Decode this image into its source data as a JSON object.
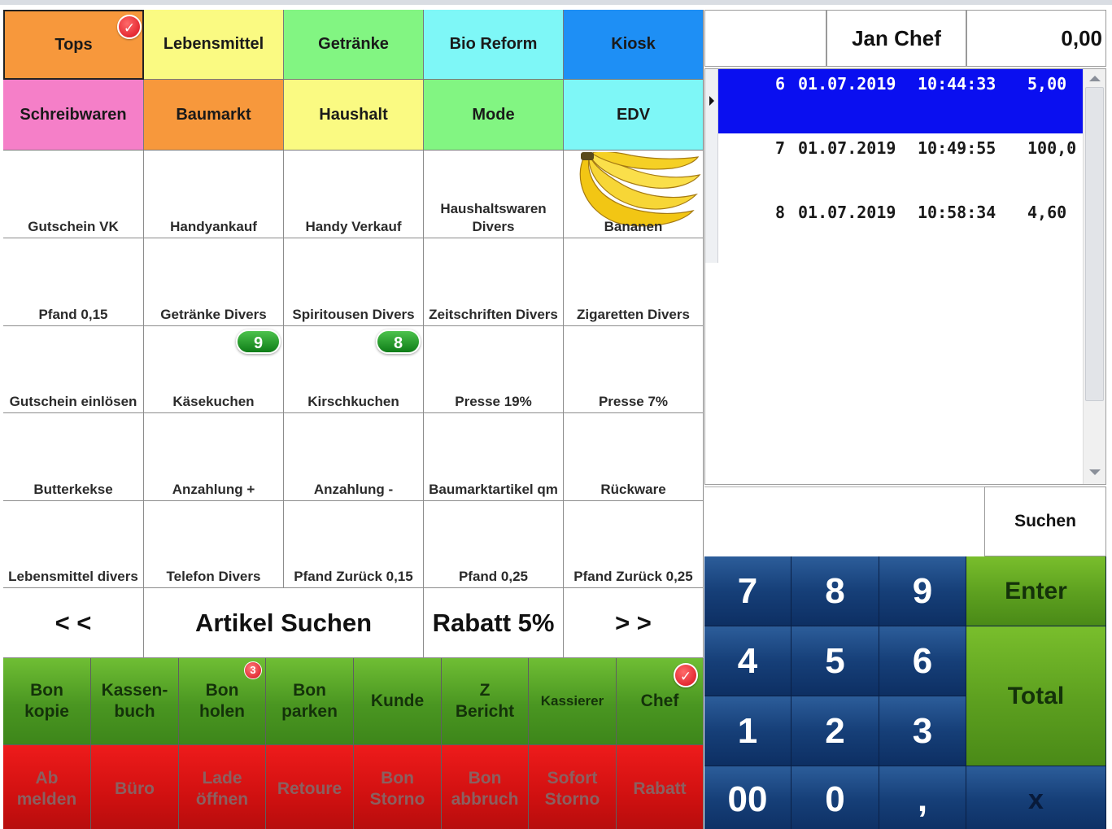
{
  "categories": [
    {
      "label": "Tops",
      "color": "#f7983c"
    },
    {
      "label": "Lebensmittel",
      "color": "#fafa82"
    },
    {
      "label": "Getränke",
      "color": "#82f582"
    },
    {
      "label": "Bio Reform",
      "color": "#7ef7f7"
    },
    {
      "label": "Kiosk",
      "color": "#1e8ff5"
    },
    {
      "label": "Schreibwaren",
      "color": "#f57fc8"
    },
    {
      "label": "Baumarkt",
      "color": "#f7983c"
    },
    {
      "label": "Haushalt",
      "color": "#fafa82"
    },
    {
      "label": "Mode",
      "color": "#82f582"
    },
    {
      "label": "EDV",
      "color": "#7ef7f7"
    }
  ],
  "tops_badge": "✓",
  "articles": [
    "Gutschein VK",
    "Handyankauf",
    "Handy Verkauf",
    "Haushaltswaren Divers",
    "Bananen",
    "Pfand 0,15",
    "Getränke Divers",
    "Spiritousen Divers",
    "Zeitschriften Divers",
    "Zigaretten Divers",
    "Gutschein einlösen",
    "Käsekuchen",
    "Kirschkuchen",
    "Presse 19%",
    "Presse 7%",
    "Butterkekse",
    "Anzahlung +",
    "Anzahlung -",
    "Baumarktartikel qm",
    "Rückware",
    "Lebensmittel divers",
    "Telefon Divers",
    "Pfand Zurück 0,15",
    "Pfand 0,25",
    "Pfand Zurück 0,25"
  ],
  "article_badges": {
    "kaesekuchen": "9",
    "kirschkuchen": "8"
  },
  "nav": {
    "prev": "< <",
    "search": "Artikel Suchen",
    "discount": "Rabatt 5%",
    "next": "> >"
  },
  "functions_green": [
    "Bon kopie",
    "Kassen- buch",
    "Bon holen",
    "Bon parken",
    "Kunde",
    "Z Bericht",
    "Kassierer",
    "Chef"
  ],
  "bon_holen_badge": "3",
  "chef_badge": "✓",
  "functions_red": [
    "Ab melden",
    "Büro",
    "Lade öffnen",
    "Retoure",
    "Bon Storno",
    "Bon abbruch",
    "Sofort Storno",
    "Rabatt"
  ],
  "header": {
    "cashier": "Jan Chef",
    "total": "0,00"
  },
  "receipts": [
    {
      "no": "6",
      "date": "01.07.2019",
      "time": "10:44:33",
      "amount": "5,00"
    },
    {
      "no": "7",
      "date": "01.07.2019",
      "time": "10:49:55",
      "amount": "100,0"
    },
    {
      "no": "8",
      "date": "01.07.2019",
      "time": "10:58:34",
      "amount": "4,60"
    }
  ],
  "search_button": "Suchen",
  "numpad": {
    "k7": "7",
    "k8": "8",
    "k9": "9",
    "enter": "Enter",
    "k4": "4",
    "k5": "5",
    "k6": "6",
    "total": "Total",
    "k1": "1",
    "k2": "2",
    "k3": "3",
    "k00": "00",
    "k0": "0",
    "comma": ",",
    "x": "x"
  }
}
